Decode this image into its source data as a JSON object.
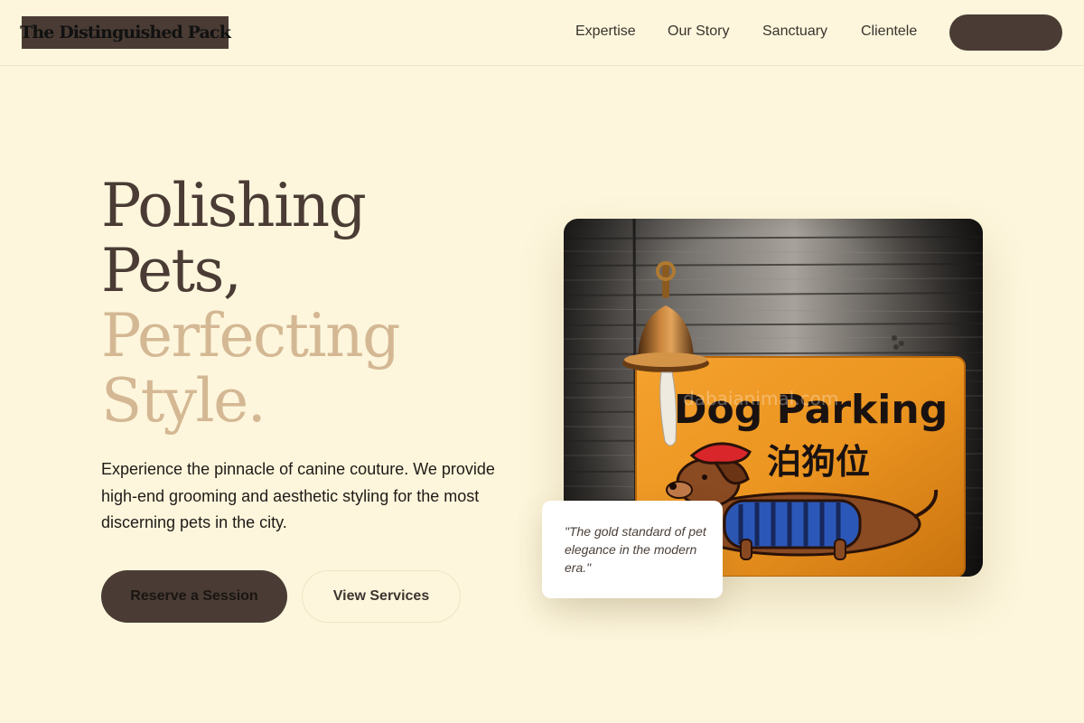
{
  "brand": {
    "name": "The Distinguished Pack"
  },
  "nav": {
    "links": [
      "Expertise",
      "Our Story",
      "Sanctuary",
      "Clientele"
    ],
    "cta_label": ""
  },
  "hero": {
    "headline_dark": "Polishing Pets,",
    "headline_light": "Perfecting Style.",
    "description": "Experience the pinnacle of canine couture. We provide high-end grooming and aesthetic styling for the most discerning pets in the city.",
    "primary_button": "Reserve a Session",
    "secondary_button": "View Services"
  },
  "image": {
    "sign_text": "Dog Parking",
    "sign_chinese": "泊狗位",
    "watermark": "dabaianimal.com",
    "description_icon": "dog-parking-sign-image"
  },
  "quote": {
    "text": "\"The gold standard of pet elegance in the modern era.\""
  },
  "colors": {
    "background": "#fdf6dc",
    "brand_dark": "#4a3c34",
    "accent_tan": "#d4b894",
    "card": "#ffffff"
  }
}
